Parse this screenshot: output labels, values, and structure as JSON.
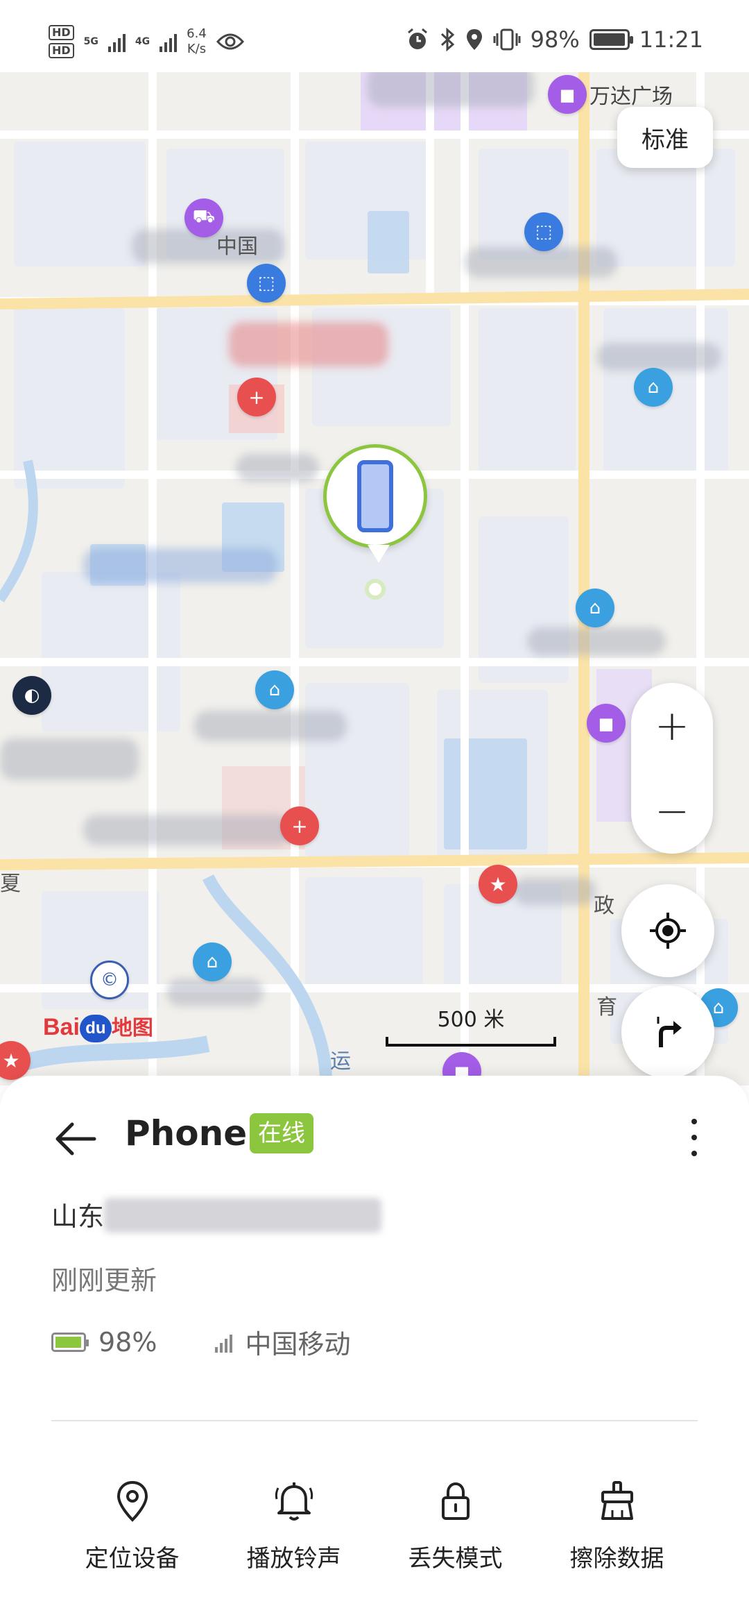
{
  "status_bar": {
    "sim1": "HD",
    "sim2": "HD",
    "net1": "5G",
    "net2": "4G",
    "speed_value": "6.4",
    "speed_unit": "K/s",
    "battery_percent": "98%",
    "battery_level": 0.98,
    "time": "11:21",
    "icons": [
      "eye-icon",
      "alarm-icon",
      "bluetooth-icon",
      "location-icon",
      "vibrate-icon",
      "battery-icon"
    ]
  },
  "map": {
    "layer_button": "标准",
    "zoom_in": "+",
    "zoom_out": "−",
    "scale_label": "500 米",
    "logo": {
      "brand": "Bai",
      "mark": "du",
      "suffix": "地图"
    },
    "labels": [
      "万达广场",
      "中国",
      "夏",
      "政",
      "育",
      "运"
    ]
  },
  "device": {
    "name": "Phone",
    "status": "在线",
    "address_prefix": "山东",
    "updated": "刚刚更新",
    "battery": "98%",
    "battery_level": 0.98,
    "carrier": "中国移动",
    "accent_color": "#8cc63f"
  },
  "actions": [
    {
      "label": "定位设备",
      "icon": "location-pin-icon"
    },
    {
      "label": "播放铃声",
      "icon": "bell-icon"
    },
    {
      "label": "丢失模式",
      "icon": "lock-icon"
    },
    {
      "label": "擦除数据",
      "icon": "eraser-icon"
    }
  ]
}
